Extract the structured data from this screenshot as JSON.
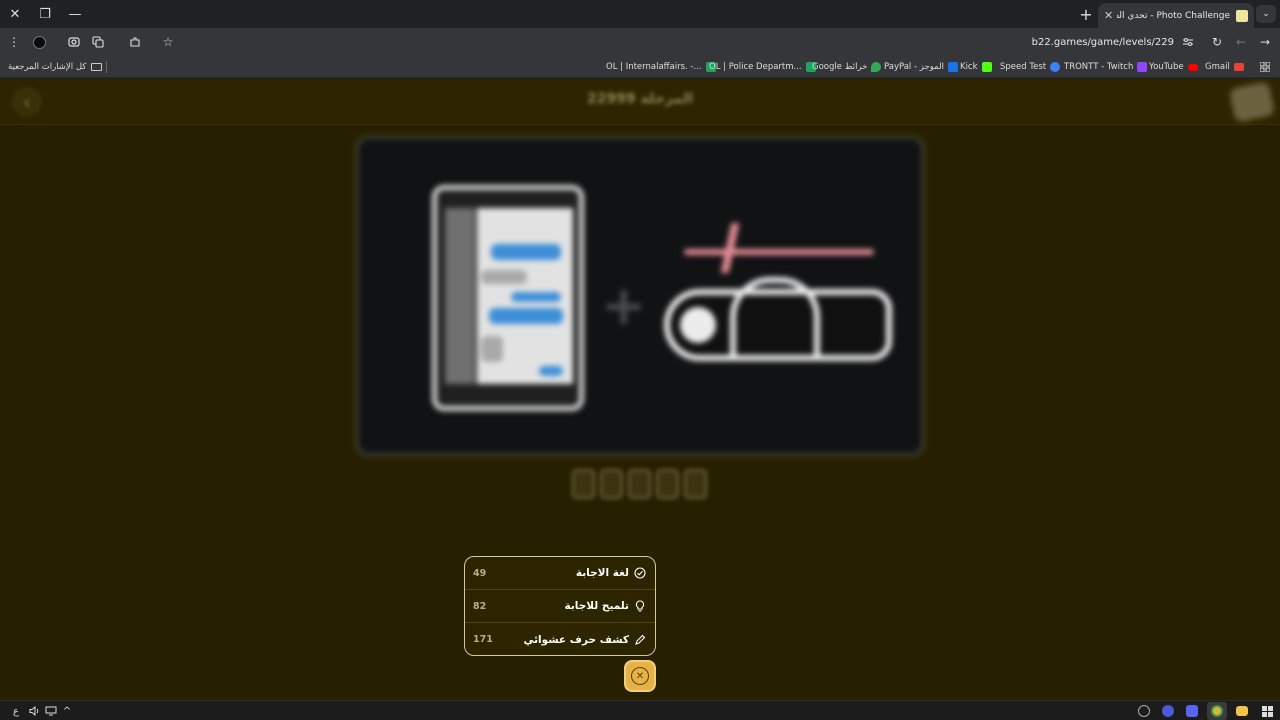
{
  "window": {
    "close_glyph": "✕",
    "restore_glyph": "❐",
    "minimize_glyph": "—"
  },
  "tabs": {
    "new_tab_glyph": "+",
    "active_title": "Photo Challenge - تحدي الصور",
    "close_glyph": "✕",
    "list_glyph": "⌄"
  },
  "toolbar": {
    "url": "b22.games/game/levels/229",
    "menu_glyph": "⋮",
    "bookmark_glyph": "☆",
    "reload_glyph": "↻",
    "back_glyph": "←",
    "forward_glyph": "→"
  },
  "bookmarks": {
    "all_label": "كل الإشارات المرجعية",
    "items": [
      {
        "label": "OL | Internalaffairs. -...",
        "color": "#1fa463"
      },
      {
        "label": "OL | Police Departm...",
        "color": "#1fa463"
      },
      {
        "label": "Google خرائط",
        "color": "#34a853"
      },
      {
        "label": "PayPal - الموجز",
        "color": "#1a73e8"
      },
      {
        "label": "Kick",
        "color": "#53fc18"
      },
      {
        "label": "Speed Test",
        "color": "#3b82f6"
      },
      {
        "label": "TRONTT - Twitch",
        "color": "#9146ff"
      },
      {
        "label": "YouTube",
        "color": "#ff0000"
      },
      {
        "label": "Gmail",
        "color": "#ea4335"
      }
    ]
  },
  "game": {
    "level_title": "المرحلة 22999",
    "back_glyph": "‹",
    "plus_glyph": "+",
    "answer_slots": 5,
    "hints": [
      {
        "label": "لغة الاجابة",
        "cost": "49",
        "icon": "check-circle-icon"
      },
      {
        "label": "تلميح للاجابة",
        "cost": "82",
        "icon": "lightbulb-icon"
      },
      {
        "label": "كشف حرف عشوائي",
        "cost": "171",
        "icon": "pencil-icon"
      }
    ],
    "close_glyph": "✕"
  },
  "taskbar": {
    "lang": "ع",
    "volume_glyph": "🔈",
    "chevron_glyph": "^"
  }
}
